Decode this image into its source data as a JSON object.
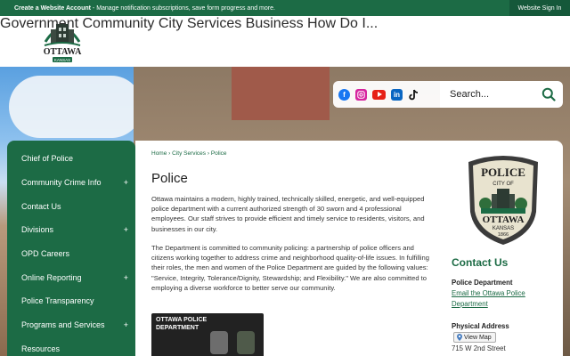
{
  "topbar": {
    "create_account_bold": "Create a Website Account",
    "create_account_text": " - Manage notification subscriptions, save form progress and more.",
    "sign_in": "Website Sign In"
  },
  "logo": {
    "name": "OTTAWA",
    "sub": "KANSAS"
  },
  "nav": {
    "items": [
      "Government",
      "Community",
      "City Services",
      "Business",
      "How Do I..."
    ]
  },
  "social": {
    "icons": [
      "facebook-icon",
      "instagram-icon",
      "youtube-icon",
      "linkedin-icon",
      "tiktok-icon"
    ]
  },
  "search": {
    "placeholder": "Search..."
  },
  "sidebar": {
    "items": [
      {
        "label": "Chief of Police",
        "expandable": false
      },
      {
        "label": "Community Crime Info",
        "expandable": true
      },
      {
        "label": "Contact Us",
        "expandable": false
      },
      {
        "label": "Divisions",
        "expandable": true
      },
      {
        "label": "OPD Careers",
        "expandable": false
      },
      {
        "label": "Online Reporting",
        "expandable": true
      },
      {
        "label": "Police Transparency",
        "expandable": false
      },
      {
        "label": "Programs and Services",
        "expandable": true
      },
      {
        "label": "Resources",
        "expandable": false
      }
    ],
    "plus": "+"
  },
  "breadcrumb": {
    "home": "Home",
    "sep": " › ",
    "section": "City Services",
    "current": "Police"
  },
  "main": {
    "title": "Police",
    "para1": "Ottawa maintains a modern, highly trained, technically skilled, energetic, and well-equipped police department with a current authorized strength of 30 sworn and 4 professional employees. Our staff strives to provide efficient and timely service to residents, visitors, and businesses in our city.",
    "para2": "The Department is committed to community policing: a partnership of police officers and citizens working together to address crime and neighborhood quality-of-life issues. In fulfilling their roles, the men and women of the Police Department are guided by the following values: \"Service, Integrity, Tolerance/Dignity, Stewardship; and Flexibility.\" We are also committed to employing a diverse workforce to better serve our community.",
    "photo_title_1": "OTTAWA POLICE",
    "photo_title_2": "DEPARTMENT"
  },
  "seal": {
    "top": "POLICE",
    "city_of": "CITY OF",
    "city": "OTTAWA",
    "state": "KANSAS",
    "year": "1866"
  },
  "contact": {
    "heading": "Contact Us",
    "dept_label": "Police Department",
    "email_link": "Email the Ottawa Police Department",
    "address_label": "Physical Address",
    "map_button": "View Map",
    "address": "715 W 2nd Street"
  },
  "colors": {
    "brand_green": "#1c6b45",
    "dark_green": "#15583a"
  }
}
